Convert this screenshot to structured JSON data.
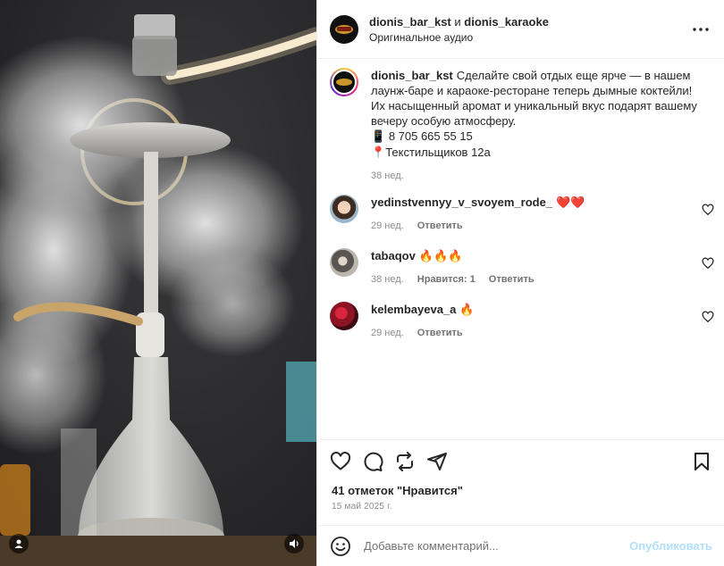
{
  "header": {
    "user1": "dionis_bar_kst",
    "conjunction": "и",
    "user2": "dionis_karaoke",
    "audio": "Оригинальное аудио",
    "more_icon": "more-horizontal-icon"
  },
  "caption": {
    "username": "dionis_bar_kst",
    "line1": "Сделайте свой отдых еще ярче — в нашем",
    "line2": "лаунж-баре и караоке-ресторане теперь дымные коктейли!",
    "line3": "Их насыщенный аромат и уникальный вкус подарят вашему",
    "line4": "вечеру особую атмосферу.",
    "phone_icon": "📱",
    "phone": "8 705 665 55 15",
    "pin_icon": "📍",
    "address": "Текстильщиков 12а",
    "time": "38 нед."
  },
  "comments": [
    {
      "username": "yedinstvennyy_v_svoyem_rode_",
      "text": "❤️❤️",
      "time": "29 нед.",
      "likes": "",
      "reply": "Ответить"
    },
    {
      "username": "tabaqov",
      "text": "🔥🔥🔥",
      "time": "38 нед.",
      "likes": "Нравится: 1",
      "reply": "Ответить"
    },
    {
      "username": "kelembayeva_a",
      "text": "🔥",
      "time": "29 нед.",
      "likes": "",
      "reply": "Ответить"
    }
  ],
  "actions": {
    "like_icon": "heart-icon",
    "comment_icon": "comment-icon",
    "repost_icon": "repost-icon",
    "share_icon": "send-icon",
    "save_icon": "bookmark-icon"
  },
  "likes_text": "41 отметок \"Нравится\"",
  "date_text": "15 май 2025 г.",
  "add_comment": {
    "placeholder": "Добавьте комментарий...",
    "post_label": "Опубликовать"
  },
  "colors": {
    "accent": "#0095f6",
    "post_disabled": "#b2dffc",
    "muted": "#8e8e8e",
    "heart_red": "#e0245e"
  }
}
